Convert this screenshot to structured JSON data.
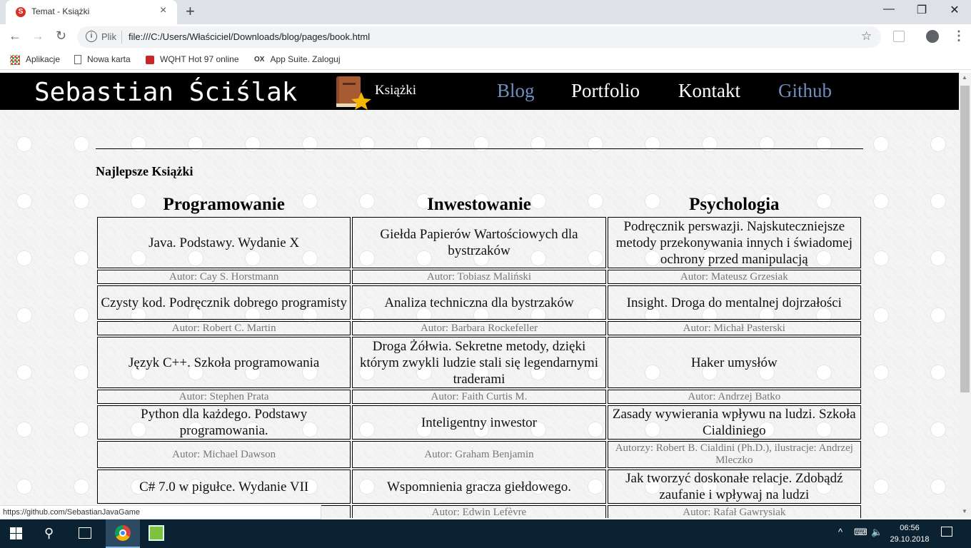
{
  "browser": {
    "tab_title": "Temat - Książki",
    "tab_favicon_letter": "S",
    "tab_close": "×",
    "new_tab": "+",
    "window_controls": [
      "—",
      "❐",
      "✕"
    ],
    "nav": {
      "back": "←",
      "forward": "→",
      "reload": "↻"
    },
    "address_info": "i",
    "address_scheme_label": "Plik",
    "address_url": "file:///C:/Users/Właściciel/Downloads/blog/pages/book.html",
    "star": "☆",
    "menu": "⋮",
    "bookmarks": [
      {
        "label": "Aplikacje",
        "icon": "apps-grid-icon"
      },
      {
        "label": "Nowa karta",
        "icon": "page-icon"
      },
      {
        "label": "WQHT Hot 97 online",
        "icon": "radio-icon"
      },
      {
        "label": "App Suite. Zaloguj",
        "icon": "ox-icon",
        "icon_text": "OX"
      }
    ],
    "status_url": "https://github.com/SebastianJavaGame"
  },
  "site": {
    "name": "Sebastian Ściślak",
    "logo_icon": "book-star-icon",
    "current_label": "Książki",
    "nav": [
      {
        "label": "Blog",
        "color": "#6f8fbe"
      },
      {
        "label": "Portfolio",
        "color": "#ffffff"
      },
      {
        "label": "Kontakt",
        "color": "#ffffff"
      },
      {
        "label": "Github",
        "color": "#6f8fbe"
      }
    ]
  },
  "page": {
    "section_title": "Najlepsze Książki",
    "columns": [
      "Programowanie",
      "Inwestowanie",
      "Psychologia"
    ],
    "rows": [
      {
        "titles": [
          "Java. Podstawy. Wydanie X",
          "Giełda Papierów Wartościowych dla bystrzaków",
          "Podręcznik perswazji. Najskuteczniejsze metody przekonywania innych i świadomej ochrony przed manipulacją"
        ],
        "authors": [
          "Autor: Cay S. Horstmann",
          "Autor: Tobiasz Maliński",
          "Autor: Mateusz Grzesiak"
        ]
      },
      {
        "titles": [
          "Czysty kod. Podręcznik dobrego programisty",
          "Analiza techniczna dla bystrzaków",
          "Insight. Droga do mentalnej dojrzałości"
        ],
        "authors": [
          "Autor: Robert C. Martin",
          "Autor: Barbara Rockefeller",
          "Autor: Michał Pasterski"
        ]
      },
      {
        "titles": [
          "Język C++. Szkoła programowania",
          "Droga Żółwia. Sekretne metody, dzięki którym zwykli ludzie stali się legendarnymi traderami",
          "Haker umysłów"
        ],
        "authors": [
          "Autor: Stephen Prata",
          "Autor: Faith Curtis M.",
          "Autor: Andrzej Batko"
        ]
      },
      {
        "titles": [
          "Python dla każdego. Podstawy programowania.",
          "Inteligentny inwestor",
          "Zasady wywierania wpływu na ludzi. Szkoła Cialdiniego"
        ],
        "authors": [
          "Autor: Michael Dawson",
          "Autor: Graham Benjamin",
          "Autorzy: Robert B. Cialdini (Ph.D.), ilustracje: Andrzej Mleczko"
        ]
      },
      {
        "titles": [
          "C# 7.0 w pigułce. Wydanie VII",
          "Wspomnienia gracza giełdowego.",
          "Jak tworzyć doskonałe relacje. Zdobądź zaufanie i wpływaj na ludzi"
        ],
        "authors": [
          "",
          "Autor: Edwin Lefèvre",
          "Autor: Rafał Gawrysiak"
        ]
      }
    ]
  },
  "taskbar": {
    "search": "⚲",
    "tray": [
      "^",
      "⌨",
      "🔈"
    ],
    "time": "06:56",
    "date": "29.10.2018"
  }
}
